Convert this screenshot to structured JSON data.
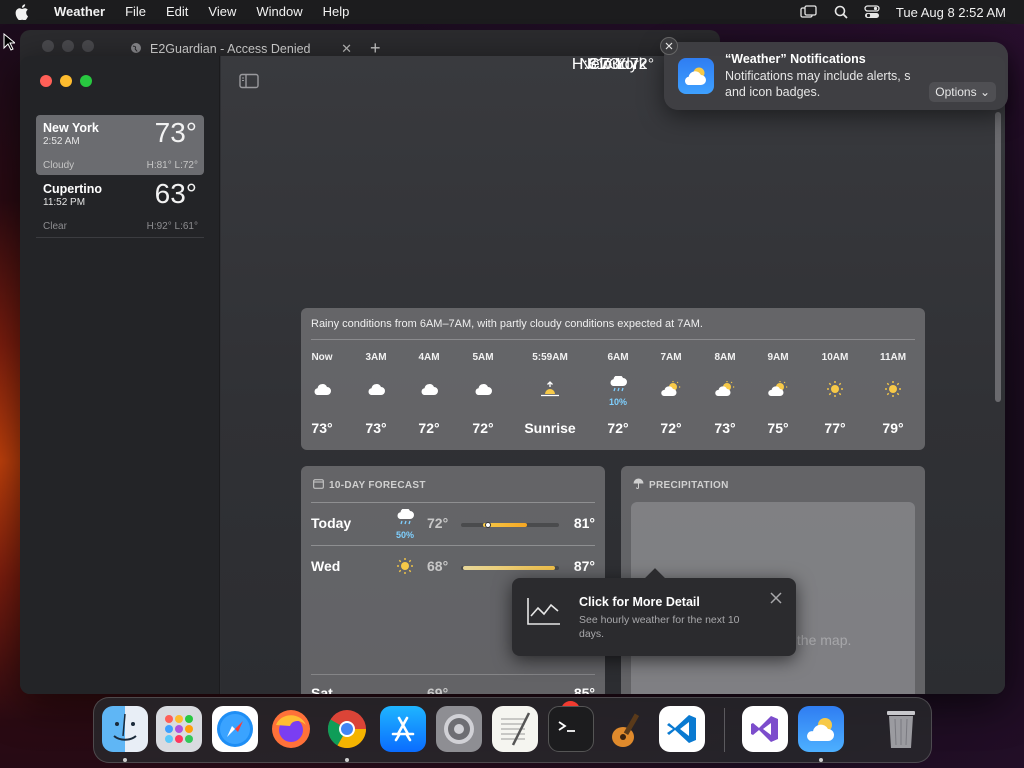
{
  "menubar": {
    "app_name": "Weather",
    "items": [
      "File",
      "Edit",
      "View",
      "Window",
      "Help"
    ],
    "clock": "Tue Aug 8  2:52 AM"
  },
  "background_browser": {
    "tab_title": "E2Guardian - Access Denied",
    "tab_close": "✕",
    "new_tab": "+"
  },
  "sidebar": {
    "cities": [
      {
        "name": "New York",
        "time": "2:52 AM",
        "temp": "73°",
        "condition": "Cloudy",
        "high_low": "H:81°  L:72°"
      },
      {
        "name": "Cupertino",
        "time": "11:52 PM",
        "temp": "63°",
        "condition": "Clear",
        "high_low": "H:92°  L:61°"
      }
    ]
  },
  "current": {
    "location": "New York",
    "temp": "73°",
    "condition": "Cloudy",
    "high_low": "H:81°  L:72°"
  },
  "hourly": {
    "summary": "Rainy conditions from 6AM–7AM, with partly cloudy conditions expected at 7AM.",
    "hours": [
      {
        "label": "Now",
        "icon": "cloud-icon",
        "temp": "73°"
      },
      {
        "label": "3AM",
        "icon": "cloud-icon",
        "temp": "73°"
      },
      {
        "label": "4AM",
        "icon": "cloud-icon",
        "temp": "72°"
      },
      {
        "label": "5AM",
        "icon": "cloud-icon",
        "temp": "72°"
      },
      {
        "label": "5:59AM",
        "icon": "sunrise-icon",
        "temp": "Sunrise"
      },
      {
        "label": "6AM",
        "icon": "rain-cloud-icon",
        "precip": "10%",
        "temp": "72°"
      },
      {
        "label": "7AM",
        "icon": "partly-cloudy-icon",
        "temp": "72°"
      },
      {
        "label": "8AM",
        "icon": "partly-cloudy-icon",
        "temp": "73°"
      },
      {
        "label": "9AM",
        "icon": "partly-cloudy-icon",
        "temp": "75°"
      },
      {
        "label": "10AM",
        "icon": "sun-icon",
        "temp": "77°"
      },
      {
        "label": "11AM",
        "icon": "sun-icon",
        "temp": "79°"
      }
    ]
  },
  "forecast": {
    "title": "10-DAY FORECAST",
    "days": [
      {
        "day": "Today",
        "icon": "rain-cloud-icon",
        "precip": "50%",
        "low": "72°",
        "high": "81°"
      },
      {
        "day": "Wed",
        "icon": "sun-icon",
        "low": "68°",
        "high": "87°"
      }
    ],
    "partial_row_day": "Sat",
    "partial_row_high": "85°",
    "partial_row_low": "69°"
  },
  "precipitation": {
    "title": "PRECIPITATION",
    "message": "Couldn't display the map."
  },
  "popover": {
    "title": "Click for More Detail",
    "body": "See hourly weather for the next 10 days."
  },
  "notification": {
    "title": "“Weather” Notifications",
    "body": "Notifications may include alerts, s... and icon badges.",
    "body_line1": "Notifications may include alerts, s",
    "body_line2": "and icon badges.",
    "options": "Options"
  },
  "dock": {
    "apps": [
      "Finder",
      "Launchpad",
      "Safari",
      "Firefox",
      "Chrome",
      "App Store",
      "System Settings",
      "TextEdit",
      "Terminal",
      "GarageBand",
      "Visual Studio Code",
      "Visual Studio",
      "Weather",
      "Trash"
    ],
    "settings_badge": "1"
  },
  "colors": {
    "accent_blue": "#3ea0ff",
    "precip_blue": "#7fd0ff",
    "sun_yellow": "#f7c948",
    "close_red": "#ff5f57",
    "minimize_yellow": "#febc2e",
    "zoom_green": "#28c840"
  }
}
